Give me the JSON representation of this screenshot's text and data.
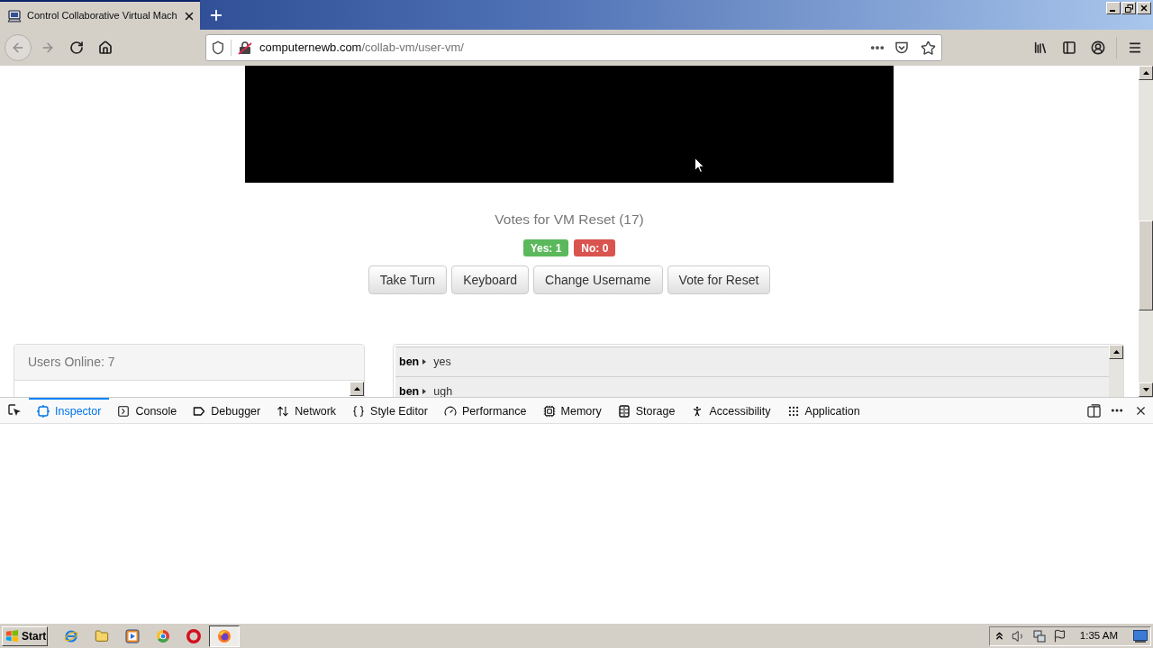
{
  "browser": {
    "tabs": [
      {
        "title": "Control Collaborative Virtual Mach",
        "selected": true
      }
    ],
    "address": {
      "domain": "computernewb.com",
      "path": "/collab-vm/user-vm/"
    }
  },
  "page": {
    "votes": {
      "title": "Votes for VM Reset (17)",
      "badges": [
        {
          "label": "Yes: 1",
          "color": "#5cb85c"
        },
        {
          "label": "No: 0",
          "color": "#d9534f"
        }
      ]
    },
    "buttons": [
      "Take Turn",
      "Keyboard",
      "Change Username",
      "Vote for Reset"
    ],
    "users_panel": {
      "title": "Users Online: 7"
    },
    "chat": [
      {
        "user": "ben",
        "message": "yes"
      },
      {
        "user": "ben",
        "message": "ugh"
      }
    ]
  },
  "devtools": {
    "tabs": [
      {
        "kind": "inspector",
        "label": "Inspector",
        "selected": true
      },
      {
        "kind": "console",
        "label": "Console",
        "selected": false
      },
      {
        "kind": "debugger",
        "label": "Debugger",
        "selected": false
      },
      {
        "kind": "network",
        "label": "Network",
        "selected": false
      },
      {
        "kind": "style-editor",
        "label": "Style Editor",
        "selected": false
      },
      {
        "kind": "performance",
        "label": "Performance",
        "selected": false
      },
      {
        "kind": "memory",
        "label": "Memory",
        "selected": false
      },
      {
        "kind": "storage",
        "label": "Storage",
        "selected": false
      },
      {
        "kind": "accessibility",
        "label": "Accessibility",
        "selected": false
      },
      {
        "kind": "application",
        "label": "Application",
        "selected": false
      }
    ]
  },
  "taskbar": {
    "start": "Start",
    "apps": [
      {
        "kind": "e-browser",
        "active": false
      },
      {
        "kind": "folder",
        "active": false
      },
      {
        "kind": "player",
        "active": false
      },
      {
        "kind": "ring-browser",
        "active": false
      },
      {
        "kind": "o-browser",
        "active": false
      },
      {
        "kind": "fox-browser",
        "active": true
      }
    ],
    "clock": "1:35 AM"
  }
}
